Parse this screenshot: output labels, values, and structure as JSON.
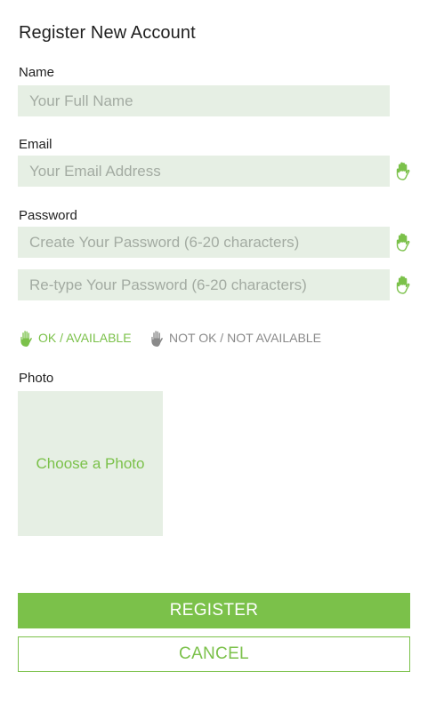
{
  "form": {
    "title": "Register New Account",
    "name": {
      "label": "Name",
      "placeholder": "Your Full Name",
      "value": ""
    },
    "email": {
      "label": "Email",
      "placeholder": "Your Email Address",
      "value": "",
      "status_icon": "hand-ok-icon"
    },
    "password": {
      "label": "Password",
      "placeholder": "Create Your Password (6-20 characters)",
      "value": "",
      "status_icon": "hand-ok-icon"
    },
    "password_confirm": {
      "placeholder": "Re-type Your Password (6-20 characters)",
      "value": "",
      "status_icon": "hand-ok-icon"
    },
    "legend": {
      "ok_label": "OK / AVAILABLE",
      "not_ok_label": "NOT OK / NOT AVAILABLE",
      "ok_icon": "hand-ok-icon",
      "not_ok_icon": "hand-not-ok-icon"
    },
    "photo": {
      "label": "Photo",
      "button_label": "Choose a Photo"
    },
    "register_label": "REGISTER",
    "cancel_label": "CANCEL"
  },
  "colors": {
    "accent": "#7bc14a",
    "field_background": "#e6efe4",
    "not_ok": "#8a8a8a"
  }
}
